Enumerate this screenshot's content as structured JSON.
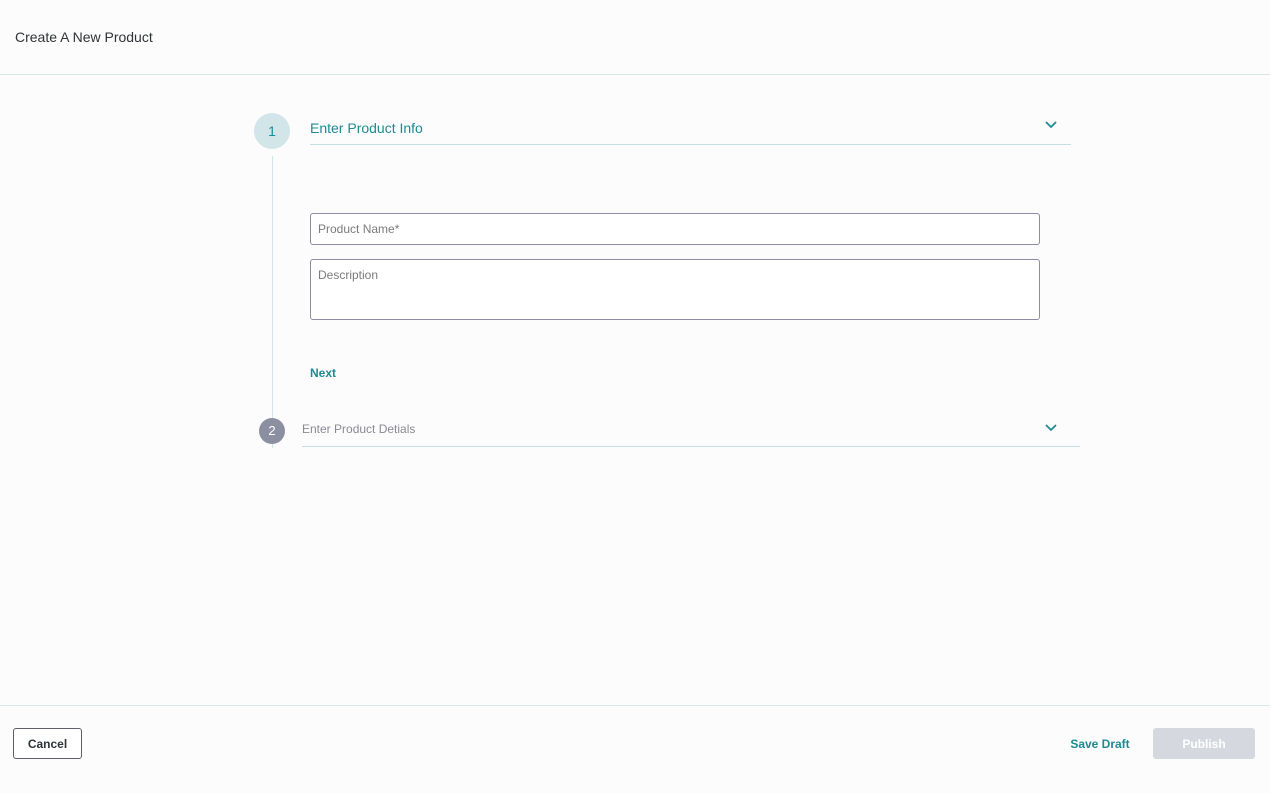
{
  "header": {
    "title": "Create A New Product"
  },
  "stepper": {
    "step1": {
      "number": "1",
      "title": "Enter Product Info",
      "fields": {
        "product_name_placeholder": "Product Name*",
        "product_name_value": "",
        "description_placeholder": "Description",
        "description_value": ""
      },
      "next_label": "Next",
      "state": "active"
    },
    "step2": {
      "number": "2",
      "title": "Enter Product Detials",
      "state": "inactive"
    },
    "icons": {
      "expand": "chevron-down-icon"
    }
  },
  "footer": {
    "cancel_label": "Cancel",
    "save_draft_label": "Save Draft",
    "publish_label": "Publish",
    "publish_enabled": false
  },
  "colors": {
    "accent": "#1e8a93",
    "step_active_bg": "#d2e6e9",
    "step_inactive_bg": "#8b8fa2",
    "field_border": "#8f8ba8",
    "publish_disabled_bg": "#d5d8df",
    "divider": "#d6e8e8"
  }
}
